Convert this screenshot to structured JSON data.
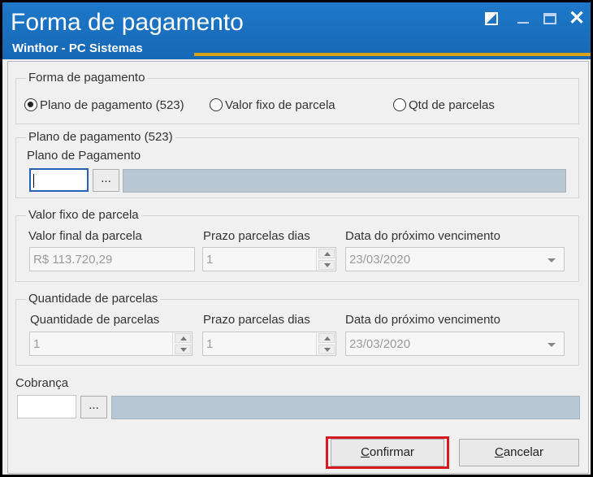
{
  "window": {
    "title": "Forma de pagamento",
    "subtitle": "Winthor - PC Sistemas",
    "controls": {
      "restore_icon": "restore-icon",
      "minimize_icon": "minimize-icon",
      "maximize_icon": "maximize-icon",
      "close_glyph": "✕"
    }
  },
  "forma_pagamento": {
    "legend": "Forma de pagamento",
    "options": [
      {
        "label": "Plano de pagamento (523)",
        "checked": true
      },
      {
        "label": "Valor fixo de parcela",
        "checked": false
      },
      {
        "label": "Qtd de parcelas",
        "checked": false
      }
    ]
  },
  "plano": {
    "legend": "Plano de pagamento (523)",
    "field_label": "Plano de Pagamento",
    "code_value": "",
    "lookup_label": "...",
    "description": ""
  },
  "valor_fixo": {
    "legend": "Valor fixo de parcela",
    "valor_label": "Valor final da parcela",
    "valor_value": "R$ 113.720,29",
    "prazo_label": "Prazo parcelas dias",
    "prazo_value": "1",
    "data_label": "Data do próximo vencimento",
    "data_value": "23/03/2020"
  },
  "quantidade": {
    "legend": "Quantidade de parcelas",
    "qtd_label": "Quantidade de parcelas",
    "qtd_value": "1",
    "prazo_label": "Prazo parcelas dias",
    "prazo_value": "1",
    "data_label": "Data do próximo vencimento",
    "data_value": "23/03/2020"
  },
  "cobranca": {
    "label": "Cobrança",
    "code_value": "",
    "lookup_label": "...",
    "description": ""
  },
  "buttons": {
    "confirm_first": "C",
    "confirm_rest": "onfirmar",
    "cancel_first": "C",
    "cancel_rest": "ancelar"
  },
  "colors": {
    "titlebar": "#1668b6",
    "accent": "#d7a215",
    "highlight": "#d71920"
  }
}
